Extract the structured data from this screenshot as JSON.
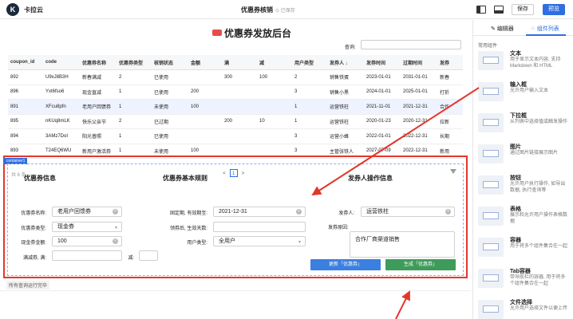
{
  "topbar": {
    "app_name": "卡拉云",
    "page_title": "优惠券核销",
    "save_state": "已保存",
    "save_label": "保存",
    "preview_label": "预览"
  },
  "canvas": {
    "title": "优惠券发放后台",
    "search_label": "查询:",
    "table": {
      "columns": [
        "coupon_id",
        "code",
        "优惠券名称",
        "优惠券类型",
        "核销状态",
        "金额",
        "满",
        "减",
        "用户类型",
        "发券人 ↓",
        "发券时间",
        "过期时间",
        "发券"
      ],
      "rows": [
        [
          "892",
          "U9xJ8B3H",
          "新春满减",
          "2",
          "已使用",
          "",
          "300",
          "100",
          "2",
          "销售铁蛋",
          "2023-01-01",
          "2031-01-01",
          "新春"
        ],
        [
          "896",
          "Yxt6fso6",
          "现金直减",
          "1",
          "已使用",
          "200",
          "",
          "",
          "3",
          "销售小黑",
          "2024-01-01",
          "2025-01-01",
          "打折"
        ],
        [
          "891",
          "XFcu8pfn",
          "老用户回馈券",
          "1",
          "未使用",
          "100",
          "",
          "",
          "1",
          "运营铁柱",
          "2021-11-01",
          "2021-12-31",
          "合作"
        ],
        [
          "895",
          "nKUq8mLK",
          "快乐父亲节",
          "2",
          "已过期",
          "",
          "200",
          "10",
          "1",
          "运营铁柱",
          "2020-01-23",
          "2020-12-31",
          "拉新"
        ],
        [
          "894",
          "3AMz7DoI",
          "阳光普照",
          "1",
          "已使用",
          "",
          "",
          "",
          "3",
          "运营小蜂",
          "2022-01-01",
          "2022-12-31",
          "长期"
        ],
        [
          "893",
          "T24EQ6WU",
          "新用户激活券",
          "1",
          "未使用",
          "100",
          "",
          "",
          "3",
          "主管张铁人",
          "2027-07-09",
          "2022-12-31",
          "新用"
        ]
      ],
      "selected_row": 2
    },
    "pager_left": "共 6 条",
    "pager_prev": "<",
    "pager_page": "1",
    "pager_next": ">"
  },
  "container": {
    "tag": "container1",
    "section1": {
      "title": "优惠券信息",
      "name_label": "优惠券名称:",
      "name_value": "老用户回馈券",
      "type_label": "优惠券类型:",
      "type_value": "现金券",
      "amount_label": "现金券金额:",
      "amount_value": "100",
      "full_label": "满减券, 满:",
      "minus_label": "减:"
    },
    "section2": {
      "title": "优惠券基本规则",
      "expire_label": "固定期, 有效期至:",
      "expire_value": "2021-12-31",
      "days_label": "领券后, 生效天数:",
      "user_type_label": "用户类型:",
      "user_type_value": "全用户"
    },
    "section3": {
      "title": "发券人操作信息",
      "issuer_label": "发券人:",
      "issuer_value": "运营铁柱",
      "reason_label": "发券原因:",
      "reason_value": "合作厂商渠道销售"
    },
    "update_button": "更新「优惠券」",
    "generate_button": "生成「优惠券」"
  },
  "status_text": "所有查询运行完毕",
  "panel": {
    "tab_editor": "编辑器",
    "tab_components": "组件列表",
    "category": "常用组件",
    "components": [
      {
        "title": "文本",
        "desc": "用于显示文本内容, 支持 Markdown 和 HTML"
      },
      {
        "title": "输入框",
        "desc": "允许用户输入文本"
      },
      {
        "title": "下拉框",
        "desc": "从列表中选择值或触发操作"
      },
      {
        "title": "图片",
        "desc": "通过图片链接展示图片"
      },
      {
        "title": "按钮",
        "desc": "允许用户执行操作, 如导出数据, 执行查询等"
      },
      {
        "title": "表格",
        "desc": "展示和允许用户操作表格数据"
      },
      {
        "title": "容器",
        "desc": "用于将多个组件集合在一起"
      },
      {
        "title": "Tab容器",
        "desc": "带导航栏的容器, 用于将多个组件集合在一起"
      },
      {
        "title": "文件选择",
        "desc": "允许用户选择文件以便上传"
      }
    ]
  },
  "colors": {
    "accent": "#2f6fe0",
    "highlight_red": "#e3372b",
    "generate_green": "#3f9b5a"
  }
}
